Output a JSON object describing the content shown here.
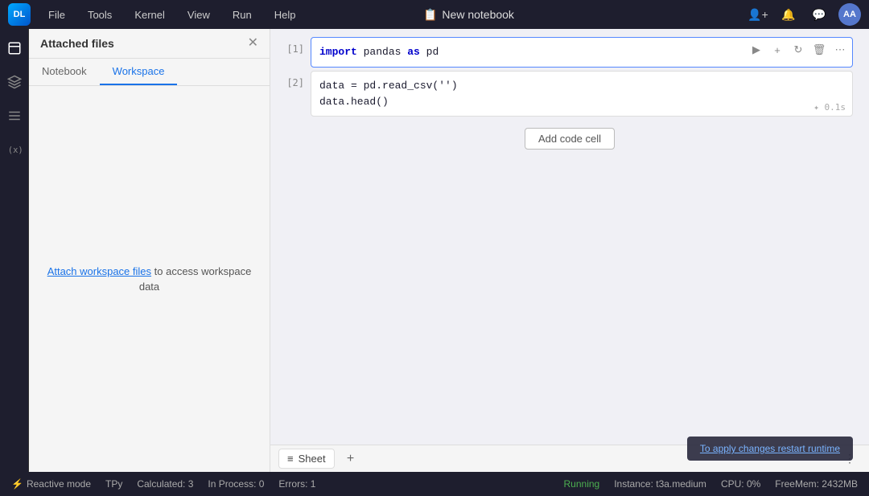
{
  "app": {
    "logo_text": "DL",
    "title": "New notebook",
    "title_icon": "📋"
  },
  "menu": {
    "items": [
      "File",
      "Tools",
      "Kernel",
      "View",
      "Run",
      "Help"
    ]
  },
  "top_right": {
    "icon1": "👤",
    "icon2": "🔔",
    "icon3": "💬",
    "avatar": "AA"
  },
  "panel": {
    "title": "Attached files",
    "tabs": [
      "Notebook",
      "Workspace"
    ],
    "active_tab": "Workspace",
    "attach_link": "Attach workspace files",
    "attach_msg": " to access workspace data"
  },
  "cells": [
    {
      "number": "[1]",
      "code_html": "<span class='kw'>import</span> pandas <span class='kw'>as</span> pd",
      "active": true
    },
    {
      "number": "[2]",
      "code_line1": "data = pd.read_csv('')",
      "code_line2": "data.head()",
      "active": false,
      "time": "0.1s"
    }
  ],
  "add_cell_label": "Add code cell",
  "sheet": {
    "tab_icon": "≡",
    "tab_name": "Sheet"
  },
  "toast": {
    "prefix": "To apply changes ",
    "link": "restart runtime",
    "suffix": ""
  },
  "status_bar": {
    "reactive_icon": "⚡",
    "reactive": "Reactive mode",
    "lang": "TPy",
    "calculated": "Calculated: 3",
    "in_process": "In Process: 0",
    "errors": "Errors: 1",
    "running": "Running",
    "instance": "Instance: t3a.medium",
    "cpu": "CPU:  0%",
    "freemem": "FreeMem:  2432MB"
  }
}
